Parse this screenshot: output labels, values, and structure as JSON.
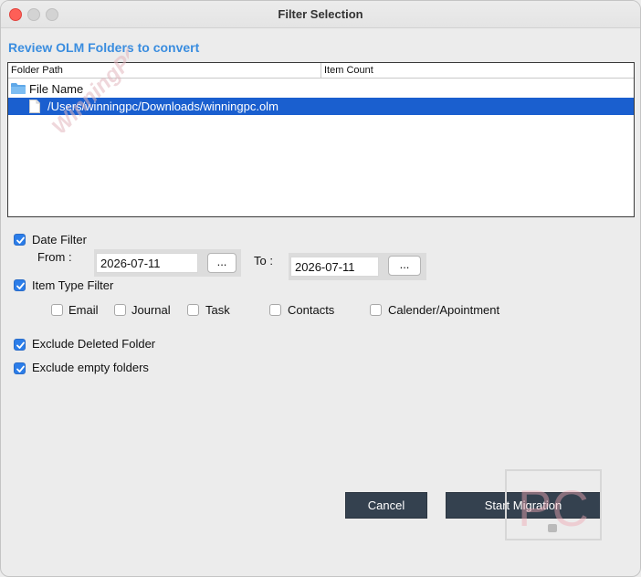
{
  "window": {
    "title": "Filter Selection"
  },
  "section_heading": "Review OLM Folders to convert",
  "tree": {
    "columns": [
      "Folder Path",
      "Item Count"
    ],
    "root_label": "File Name",
    "selected_row": "/Users/winningpc/Downloads/winningpc.olm"
  },
  "date_filter": {
    "label": "Date Filter",
    "checked": true,
    "from_label": "From :",
    "from_value": "2026-07-11",
    "to_label": "To :",
    "to_value": "2026-07-11",
    "picker_label": "..."
  },
  "item_type_filter": {
    "label": "Item Type Filter",
    "checked": true,
    "options": [
      {
        "label": "Email",
        "checked": false
      },
      {
        "label": "Journal",
        "checked": false
      },
      {
        "label": "Task",
        "checked": false
      },
      {
        "label": "Contacts",
        "checked": false
      },
      {
        "label": "Calender/Apointment",
        "checked": false
      }
    ]
  },
  "exclude_deleted": {
    "label": "Exclude Deleted Folder",
    "checked": true
  },
  "exclude_empty": {
    "label": "Exclude empty folders",
    "checked": true
  },
  "buttons": {
    "cancel": "Cancel",
    "start": "Start Migration"
  },
  "watermark": {
    "text": "WinningPC",
    "logo_text": "PC"
  },
  "colors": {
    "accent": "#3a8ddf",
    "selection": "#1a5fcf",
    "button_bg": "#34414f",
    "checkbox": "#2b7de9"
  }
}
